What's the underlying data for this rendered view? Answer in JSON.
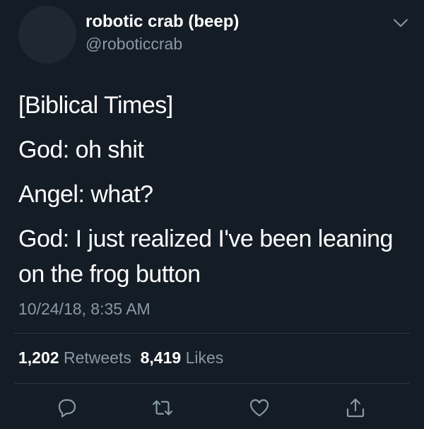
{
  "tweet": {
    "author": {
      "display_name": "robotic crab (beep)",
      "handle": "@roboticcrab"
    },
    "text_lines": [
      "[Biblical Times]",
      "God: oh shit",
      "Angel: what?",
      "God: I just realized I've been leaning",
      "on the frog button"
    ],
    "timestamp": "10/24/18, 8:35 AM",
    "stats": {
      "retweets_count": "1,202",
      "retweets_label": "Retweets",
      "likes_count": "8,419",
      "likes_label": "Likes"
    },
    "actions": [
      "reply-icon",
      "retweet-icon",
      "like-icon",
      "share-icon"
    ],
    "colors": {
      "background": "#141c26",
      "text": "#ffffff",
      "secondary_text": "#8899a6",
      "divider": "#2b3540"
    }
  }
}
